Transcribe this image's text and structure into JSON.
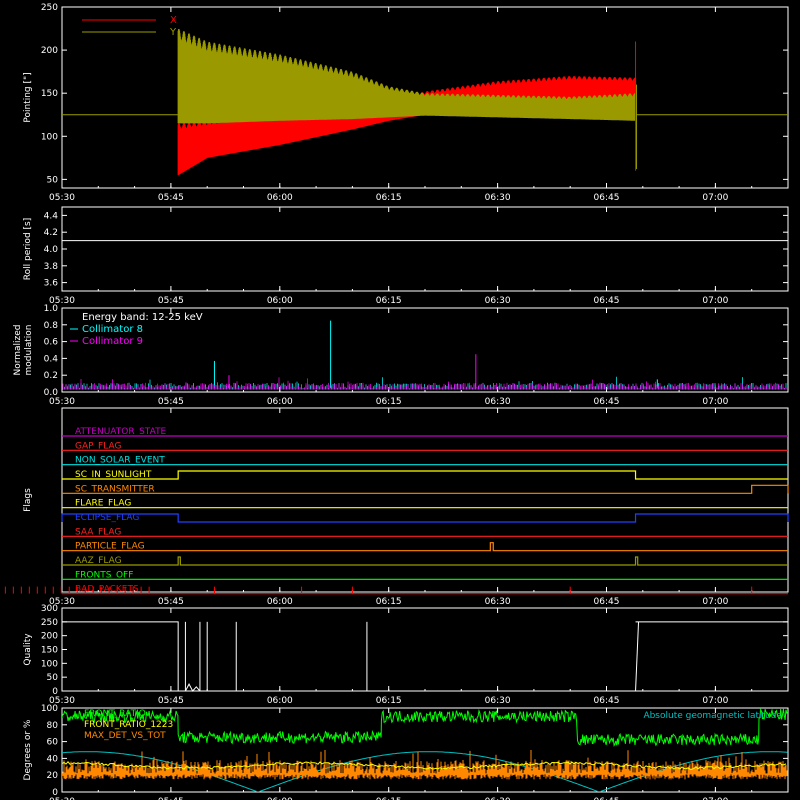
{
  "chart_data": [
    {
      "type": "line",
      "ylabel": "Pointing [\"]",
      "ylim": [
        40,
        250
      ],
      "yticks": [
        50,
        100,
        150,
        200,
        250
      ],
      "xlim": [
        "05:30",
        "07:10"
      ],
      "xtick_labels": [
        "05:30",
        "05:45",
        "06:00",
        "06:15",
        "06:30",
        "06:45",
        "07:00"
      ],
      "legend": "top-left",
      "series": [
        {
          "name": "X",
          "color": "#ff0000",
          "envelope_x": [
            "05:46",
            "05:50",
            "06:00",
            "06:10",
            "06:15",
            "06:20",
            "06:30",
            "06:40",
            "06:49"
          ],
          "upper": [
            115,
            118,
            128,
            133,
            140,
            152,
            164,
            170,
            168
          ],
          "lower": [
            55,
            75,
            90,
            108,
            118,
            125,
            130,
            136,
            138
          ]
        },
        {
          "name": "Y",
          "color": "#9a9a00",
          "envelope_x": [
            "05:46",
            "05:50",
            "06:00",
            "06:10",
            "06:15",
            "06:20",
            "06:30",
            "06:40",
            "06:49"
          ],
          "upper": [
            225,
            210,
            195,
            175,
            158,
            150,
            148,
            146,
            150
          ],
          "lower": [
            115,
            115,
            118,
            120,
            122,
            124,
            122,
            120,
            118
          ]
        }
      ],
      "baseline": 125
    },
    {
      "type": "line",
      "ylabel": "Roll period [s]",
      "ylim": [
        3.5,
        4.5
      ],
      "yticks": [
        3.6,
        3.8,
        4.0,
        4.2,
        4.4
      ],
      "series": [
        {
          "color": "#ffffff",
          "value": 4.1
        }
      ]
    },
    {
      "type": "line",
      "ylabel": "Normalized modulation",
      "ylim": [
        0,
        1.0
      ],
      "yticks": [
        0.0,
        0.2,
        0.4,
        0.6,
        0.8,
        1.0
      ],
      "annotation": "Energy band: 12-25 keV",
      "series": [
        {
          "name": "Collimator 8",
          "color": "#00ffff",
          "spikes": [
            [
              "05:51",
              0.37
            ],
            [
              "06:07",
              0.85
            ],
            [
              "06:52",
              0.15
            ]
          ]
        },
        {
          "name": "Collimator 9",
          "color": "#ff00ff",
          "spikes": [
            [
              "06:27",
              0.45
            ],
            [
              "05:53",
              0.2
            ]
          ]
        }
      ]
    },
    {
      "type": "table",
      "ylabel": "Flags",
      "flags": [
        {
          "label": "ATTENUATOR_STATE",
          "color": "#c000c0",
          "high": []
        },
        {
          "label": "GAP_FLAG",
          "color": "#ff2020",
          "high": []
        },
        {
          "label": "NON_SOLAR_EVENT",
          "color": "#00e0e0",
          "high": []
        },
        {
          "label": "SC_IN_SUNLIGHT",
          "color": "#ffff00",
          "high": [
            [
              "05:46",
              "06:49"
            ]
          ]
        },
        {
          "label": "SC_TRANSMITTER",
          "color": "#ff8800",
          "high": [
            [
              "07:05",
              "07:10"
            ]
          ]
        },
        {
          "label": "FLARE_FLAG",
          "color": "#ffff00",
          "high": []
        },
        {
          "label": "ECLIPSE_FLAG",
          "color": "#2040ff",
          "high": [
            [
              "05:30",
              "05:46"
            ],
            [
              "06:49",
              "07:10"
            ]
          ]
        },
        {
          "label": "SAA_FLAG",
          "color": "#ff2020",
          "high": []
        },
        {
          "label": "PARTICLE_FLAG",
          "color": "#ff8800",
          "high": [
            [
              "06:29",
              "06:29.4"
            ]
          ]
        },
        {
          "label": "AAZ_FLAG",
          "color": "#9a9a00",
          "high": [
            [
              "05:46",
              "05:46.3"
            ],
            [
              "06:49",
              "06:49.3"
            ]
          ]
        },
        {
          "label": "FRONTS_OFF",
          "color": "#00ff00",
          "high": []
        },
        {
          "label": "BAD_PACKETS",
          "color": "#ff0000",
          "high": []
        }
      ]
    },
    {
      "type": "line",
      "ylabel": "Quality",
      "ylim": [
        0,
        300
      ],
      "yticks": [
        0,
        50,
        100,
        150,
        200,
        250,
        300
      ],
      "series": [
        {
          "color": "#ffffff",
          "segments": [
            [
              "05:30",
              "05:46",
              250
            ],
            [
              "06:49",
              "07:10",
              250
            ]
          ],
          "spikes": [
            [
              "05:47",
              250
            ],
            [
              "05:49",
              250
            ],
            [
              "05:50",
              250
            ],
            [
              "05:54",
              250
            ],
            [
              "06:12",
              250
            ]
          ]
        }
      ]
    },
    {
      "type": "line",
      "ylabel": "Degrees or %",
      "ylim": [
        0,
        100
      ],
      "yticks": [
        0,
        20,
        40,
        60,
        80,
        100
      ],
      "series": [
        {
          "name": "FRONT_RATIO",
          "color": "#00ff00",
          "steps": [
            [
              "05:30",
              "05:46",
              90
            ],
            [
              "05:46",
              "06:14",
              65
            ],
            [
              "06:14",
              "06:41",
              90
            ],
            [
              "06:41",
              "07:06",
              62
            ],
            [
              "07:06",
              "07:10",
              92
            ]
          ]
        },
        {
          "name": "FRONT_RATIO_1223",
          "color": "#ffff00",
          "level": 32
        },
        {
          "name": "MAX_DET_VS_TOT",
          "color": "#ff8800",
          "level": 28
        },
        {
          "name": "Absolute geomagnetic latitude",
          "color": "#00c0c0"
        }
      ]
    }
  ]
}
